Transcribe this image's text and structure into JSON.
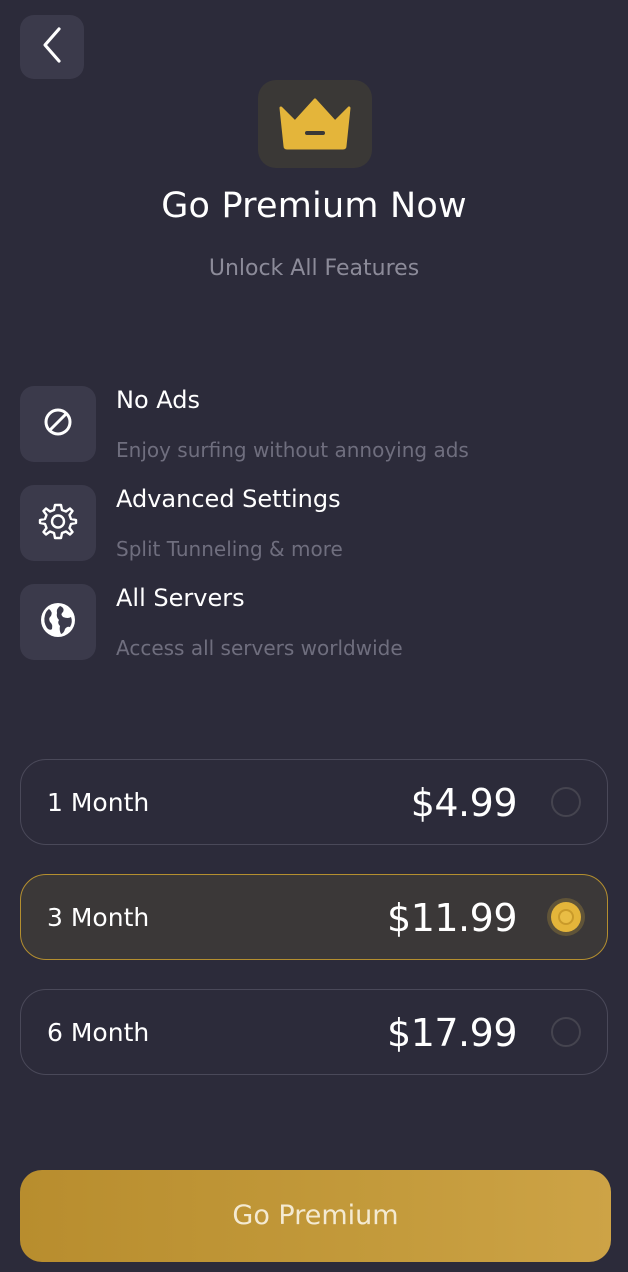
{
  "header": {
    "back_icon": "chevron-left-icon",
    "logo_icon": "crown-icon",
    "title": "Go Premium Now",
    "subtitle": "Unlock All Features"
  },
  "features": [
    {
      "icon": "block-icon",
      "title": "No Ads",
      "description": "Enjoy surfing without annoying ads"
    },
    {
      "icon": "gear-icon",
      "title": "Advanced Settings",
      "description": "Split Tunneling & more"
    },
    {
      "icon": "globe-icon",
      "title": "All Servers",
      "description": "Access all servers worldwide"
    }
  ],
  "plans": [
    {
      "duration": "1 Month",
      "price": "$4.99",
      "selected": false
    },
    {
      "duration": "3 Month",
      "price": "$11.99",
      "selected": true
    },
    {
      "duration": "6 Month",
      "price": "$17.99",
      "selected": false
    }
  ],
  "cta": {
    "label": "Go Premium"
  },
  "colors": {
    "background": "#2c2b3a",
    "accent": "#e4b53a",
    "tile": "#3b3a4b"
  }
}
